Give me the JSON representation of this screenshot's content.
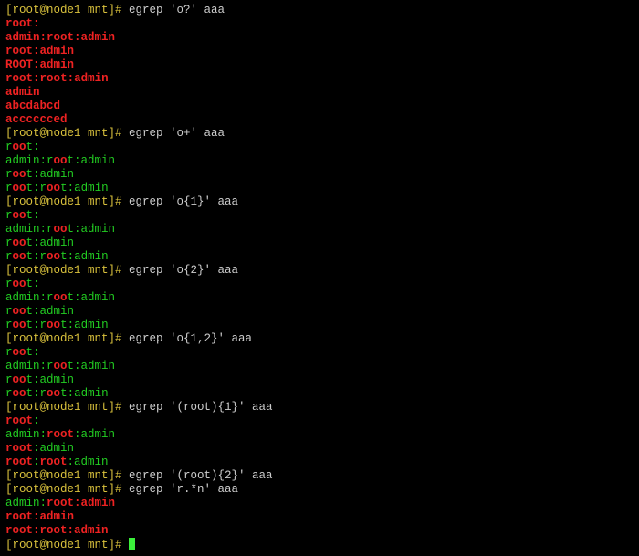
{
  "prompt": "[root@node1 mnt]# ",
  "commands": {
    "c1": "egrep 'o?' aaa",
    "c2": "egrep 'o+' aaa",
    "c3": "egrep 'o{1}' aaa",
    "c4": "egrep 'o{2}' aaa",
    "c5": "egrep 'o{1,2}' aaa",
    "c6": "egrep '(root){1}' aaa",
    "c7": "egrep '(root){2}' aaa",
    "c8": "egrep 'r.*n' aaa"
  },
  "t": {
    "r": "r",
    "o": "o",
    "oo": "oo",
    "t": "t",
    "c": ":",
    "admin": "admin",
    "adm": "adm",
    "in": "in",
    "ROOT": "ROOT",
    "roo": "roo",
    "rootroot": "root:root",
    "root": "root",
    "cadmin": ":admin",
    "abcdabcd": "abcdabcd",
    "acccccced": "acccccced",
    "admin_": "admin:",
    "n": "n",
    "i": "i",
    "root_admin": "root:admin",
    "root_root_adm": "root:root:adm",
    "root_admi": "root:admi"
  }
}
